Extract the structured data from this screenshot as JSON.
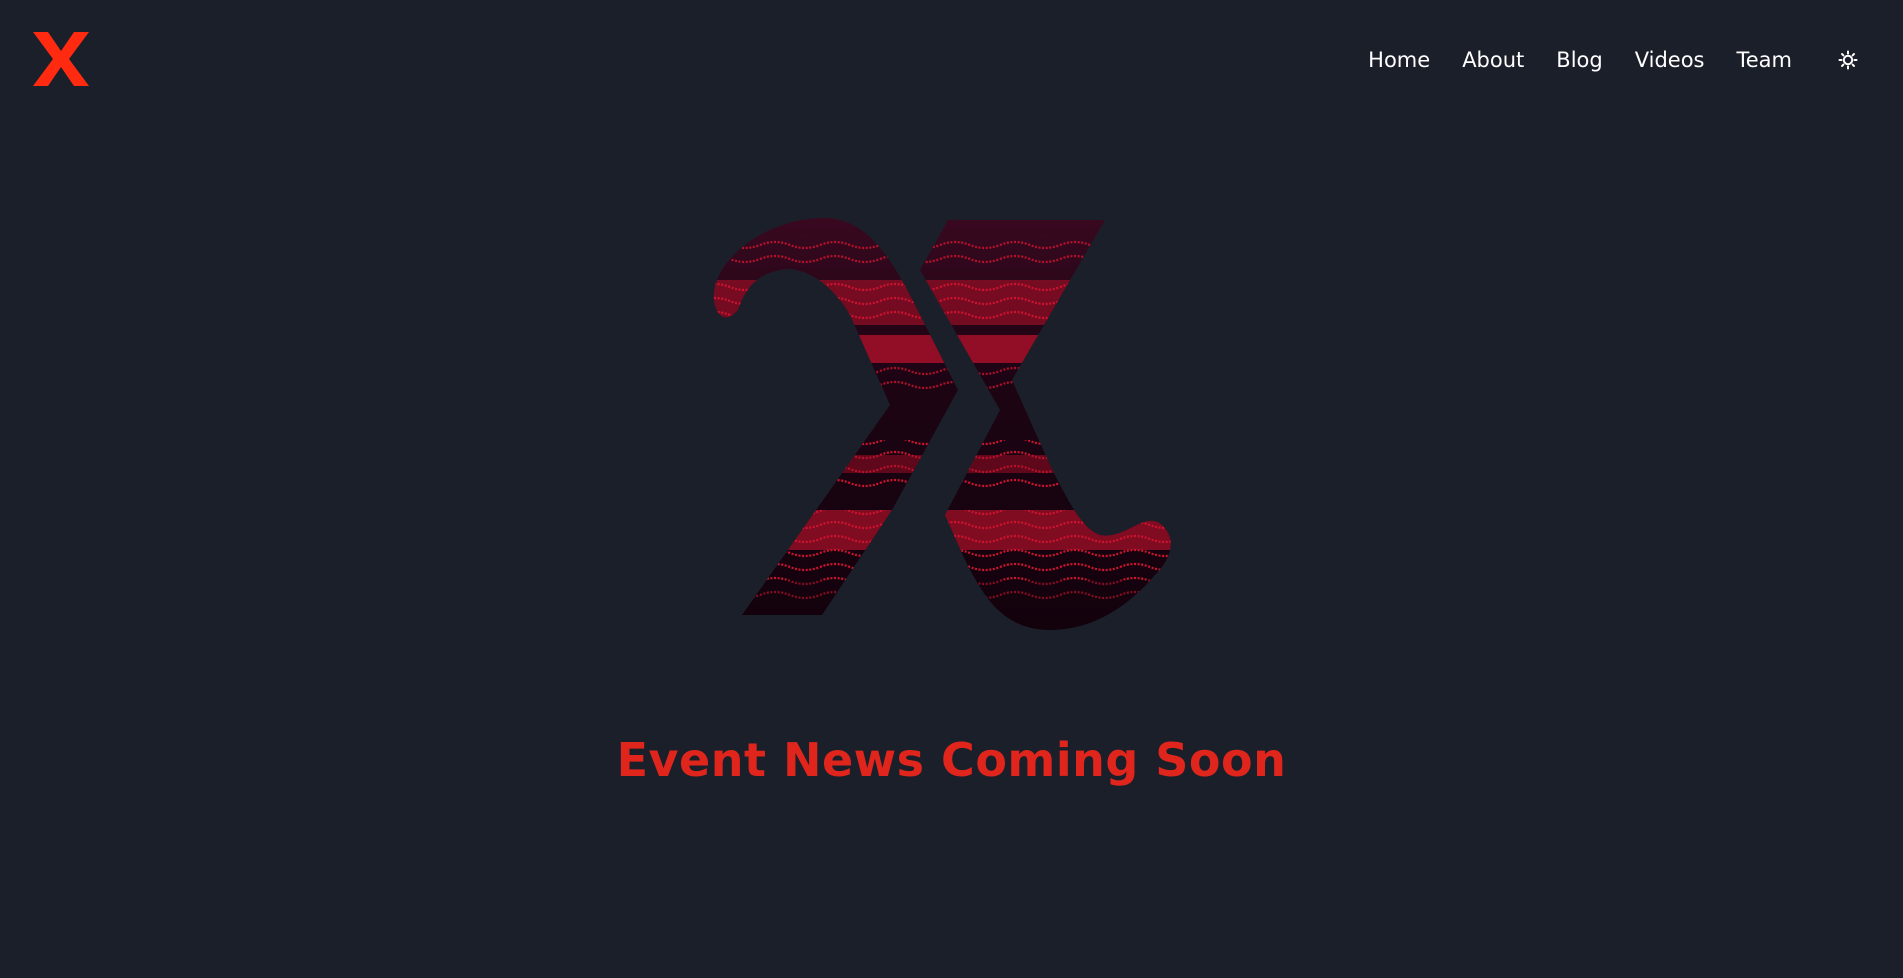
{
  "brand": {
    "logo_icon": "x-logo-icon",
    "logo_color": "#ff2a10"
  },
  "nav": {
    "items": [
      {
        "label": "Home"
      },
      {
        "label": "About"
      },
      {
        "label": "Blog"
      },
      {
        "label": "Videos"
      },
      {
        "label": "Team"
      }
    ],
    "theme_toggle_icon": "sun-icon"
  },
  "hero": {
    "image_icon": "x-letter-graphic",
    "colors": [
      "#2a0618",
      "#c0102a"
    ]
  },
  "main": {
    "headline": "Event News Coming Soon"
  },
  "colors": {
    "background": "#1b1f2a",
    "accent": "#e0261c",
    "nav_text": "#ffffff"
  }
}
